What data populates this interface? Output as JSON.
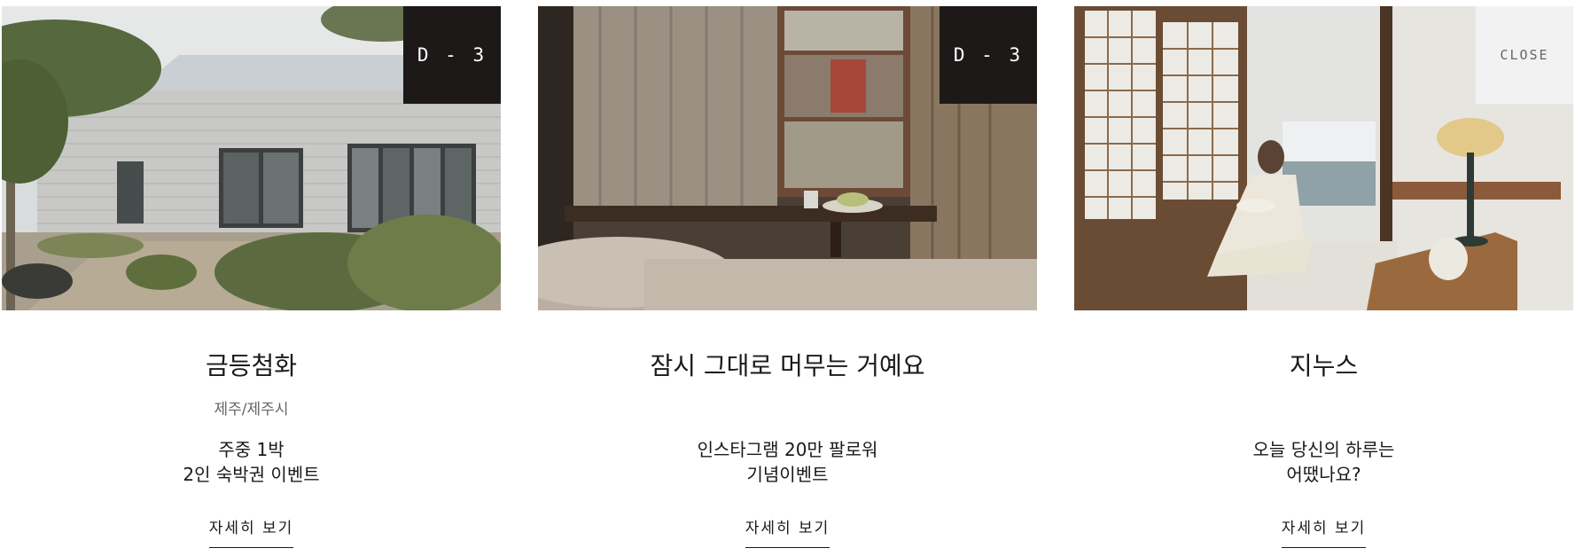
{
  "cards": [
    {
      "badge": "D - 3",
      "title": "금등첨화",
      "location": "제주/제주시",
      "description": [
        "주중 1박",
        "2인 숙박권 이벤트"
      ],
      "more_label": "자세히 보기"
    },
    {
      "badge": "D - 3",
      "title": "잠시 그대로 머무는 거예요",
      "location": "",
      "description": [
        "인스타그램 20만 팔로워",
        "기념이벤트"
      ],
      "more_label": "자세히 보기"
    },
    {
      "badge": "",
      "title": "지누스",
      "location": "",
      "description": [
        "오늘 당신의 하루는",
        "어땠나요?"
      ],
      "more_label": "자세히 보기"
    }
  ],
  "close_label": "CLOSE",
  "colors": {
    "badge_bg": "#1c1918",
    "text": "#1a1a1a",
    "subtext": "#666666",
    "close_bg": "#f3f3f3"
  },
  "images": [
    {
      "icon": "photo-house-garden-image"
    },
    {
      "icon": "photo-bedroom-window-image"
    },
    {
      "icon": "photo-woman-reading-image"
    }
  ]
}
